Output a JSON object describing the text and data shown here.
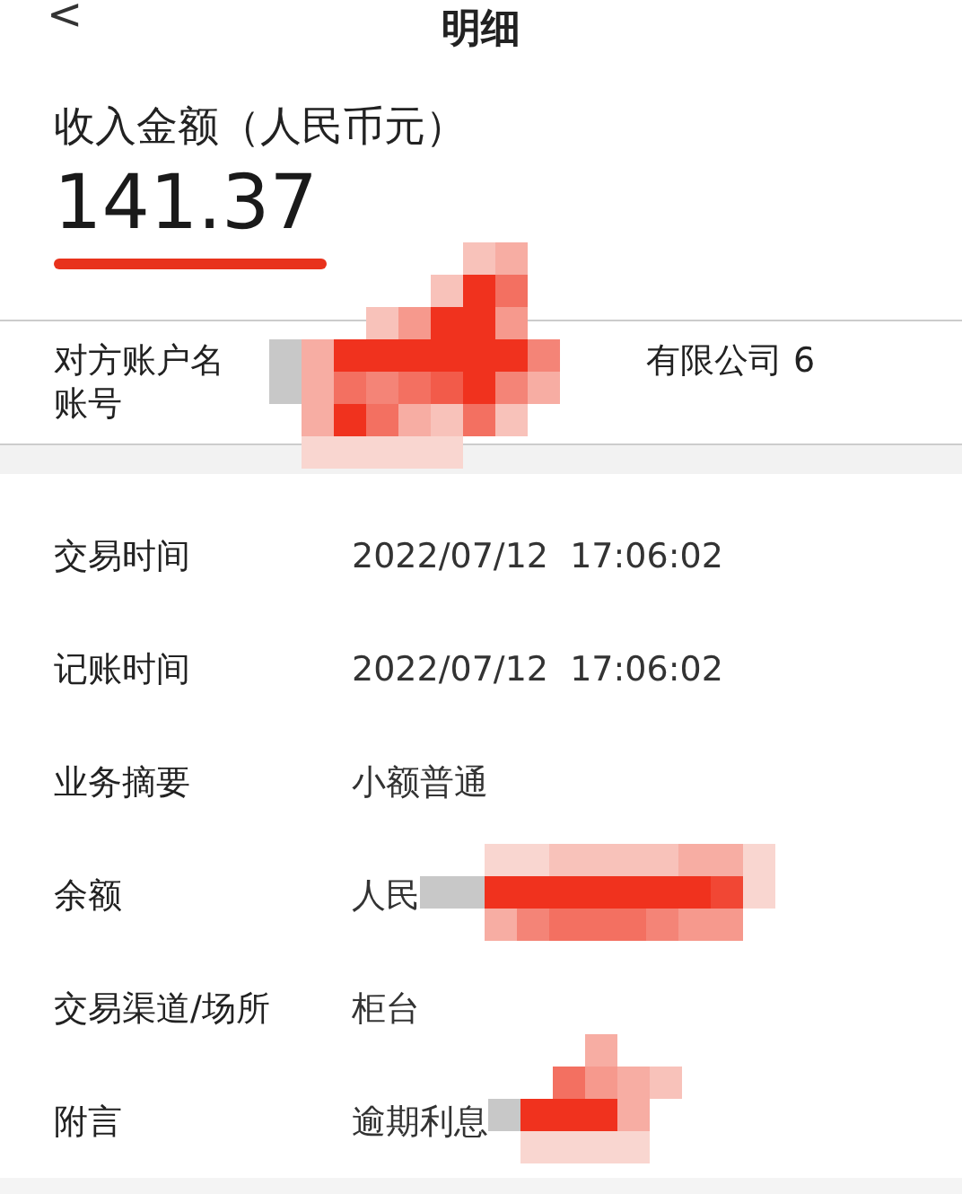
{
  "header": {
    "back": "<",
    "title": "明细"
  },
  "amount": {
    "label": "收入金额（人民币元）",
    "value": "141.37",
    "underlined": true
  },
  "counterparty": {
    "label_lines": [
      "对方账户名",
      "账号"
    ],
    "value": "有限公司 6",
    "redacted": true
  },
  "details": [
    {
      "label": "交易时间",
      "value": "2022/07/12  17:06:02",
      "redacted": false
    },
    {
      "label": "记账时间",
      "value": "2022/07/12  17:06:02",
      "redacted": false
    },
    {
      "label": "业务摘要",
      "value": "小额普通",
      "redacted": false
    },
    {
      "label": "余额",
      "value": "人民",
      "redacted": true
    },
    {
      "label": "交易渠道/场所",
      "value": "柜台",
      "redacted": false
    },
    {
      "label": "附言",
      "value": "逾期利息",
      "redacted": true
    }
  ]
}
